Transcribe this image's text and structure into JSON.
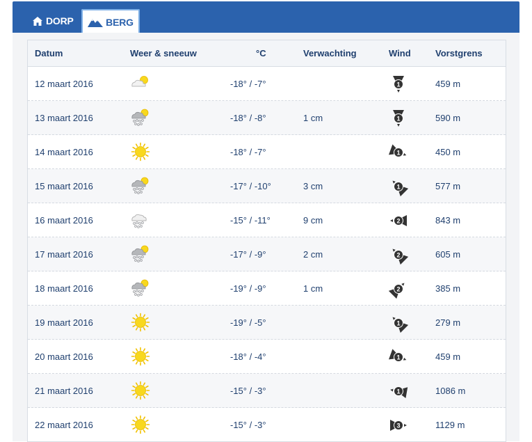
{
  "tabs": [
    {
      "label": "DORP",
      "icon": "house-icon",
      "active": false
    },
    {
      "label": "BERG",
      "icon": "mountain-icon",
      "active": true
    }
  ],
  "table": {
    "headers": {
      "date": "Datum",
      "weather": "Weer & sneeuw",
      "temp": "°C",
      "expect": "Verwachting",
      "wind": "Wind",
      "frost": "Vorstgrens"
    },
    "rows": [
      {
        "date": "12 maart 2016",
        "weather": "partly-cloudy-icon",
        "temp": "-18° / -7°",
        "expect": "",
        "wind_force": "1",
        "wind_dir_deg": 0,
        "frost": "459 m"
      },
      {
        "date": "13 maart 2016",
        "weather": "snow-sun-icon",
        "temp": "-18° / -8°",
        "expect": "1 cm",
        "wind_force": "1",
        "wind_dir_deg": 0,
        "frost": "590 m"
      },
      {
        "date": "14 maart 2016",
        "weather": "sun-icon",
        "temp": "-18° / -7°",
        "expect": "",
        "wind_force": "1",
        "wind_dir_deg": 290,
        "frost": "450 m"
      },
      {
        "date": "15 maart 2016",
        "weather": "snow-sun-icon",
        "temp": "-17° / -10°",
        "expect": "3 cm",
        "wind_force": "1",
        "wind_dir_deg": 135,
        "frost": "577 m"
      },
      {
        "date": "16 maart 2016",
        "weather": "snow-cloud-icon",
        "temp": "-15° / -11°",
        "expect": "9 cm",
        "wind_force": "2",
        "wind_dir_deg": 90,
        "frost": "843 m"
      },
      {
        "date": "17 maart 2016",
        "weather": "snow-sun-icon",
        "temp": "-17° / -9°",
        "expect": "2 cm",
        "wind_force": "2",
        "wind_dir_deg": 135,
        "frost": "605 m"
      },
      {
        "date": "18 maart 2016",
        "weather": "snow-sun-icon",
        "temp": "-19° / -9°",
        "expect": "1 cm",
        "wind_force": "2",
        "wind_dir_deg": 225,
        "frost": "385 m"
      },
      {
        "date": "19 maart 2016",
        "weather": "sun-icon",
        "temp": "-19° / -5°",
        "expect": "",
        "wind_force": "1",
        "wind_dir_deg": 135,
        "frost": "279 m"
      },
      {
        "date": "20 maart 2016",
        "weather": "sun-icon",
        "temp": "-18° / -4°",
        "expect": "",
        "wind_force": "1",
        "wind_dir_deg": 290,
        "frost": "459 m"
      },
      {
        "date": "21 maart 2016",
        "weather": "sun-icon",
        "temp": "-15° / -3°",
        "expect": "",
        "wind_force": "1",
        "wind_dir_deg": 100,
        "frost": "1086 m"
      },
      {
        "date": "22 maart 2016",
        "weather": "sun-icon",
        "temp": "-15° / -3°",
        "expect": "",
        "wind_force": "3",
        "wind_dir_deg": 270,
        "frost": "1129 m"
      }
    ]
  },
  "colors": {
    "brand": "#2b62ad",
    "text": "#1f3f6e",
    "sun": "#f7d21b"
  }
}
